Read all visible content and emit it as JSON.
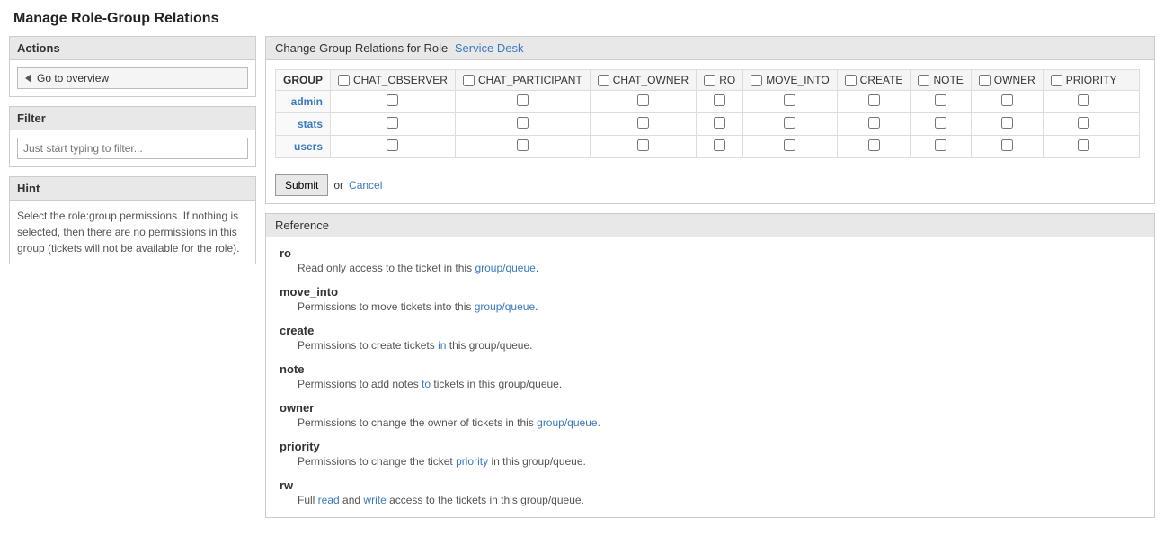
{
  "page": {
    "title": "Manage Role-Group Relations"
  },
  "sidebar": {
    "actions_title": "Actions",
    "goto_overview_label": "Go to overview",
    "filter_title": "Filter",
    "filter_placeholder": "Just start typing to filter...",
    "hint_title": "Hint",
    "hint_text": "Select the role:group permissions. If nothing is selected, then there are no permissions in this group (tickets will not be available for the role)."
  },
  "main": {
    "change_group_title_prefix": "Change Group Relations for Role",
    "role_name": "Service Desk",
    "columns": [
      {
        "id": "group",
        "label": "GROUP",
        "has_checkbox": false
      },
      {
        "id": "chat_observer",
        "label": "CHAT_OBSERVER",
        "has_checkbox": true
      },
      {
        "id": "chat_participant",
        "label": "CHAT_PARTICIPANT",
        "has_checkbox": true
      },
      {
        "id": "chat_owner",
        "label": "CHAT_OWNER",
        "has_checkbox": true
      },
      {
        "id": "ro",
        "label": "RO",
        "has_checkbox": true
      },
      {
        "id": "move_into",
        "label": "MOVE_INTO",
        "has_checkbox": true
      },
      {
        "id": "create",
        "label": "CREATE",
        "has_checkbox": true
      },
      {
        "id": "note",
        "label": "NOTE",
        "has_checkbox": true
      },
      {
        "id": "owner",
        "label": "OWNER",
        "has_checkbox": true
      },
      {
        "id": "priority",
        "label": "PRIORITY",
        "has_checkbox": true
      }
    ],
    "rows": [
      {
        "group": "admin",
        "group_link": true
      },
      {
        "group": "stats",
        "group_link": true
      },
      {
        "group": "users",
        "group_link": true
      }
    ],
    "submit_label": "Submit",
    "or_text": "or",
    "cancel_label": "Cancel",
    "reference_title": "Reference",
    "reference_items": [
      {
        "term": "ro",
        "desc_parts": [
          {
            "text": "Read only access to the ticket in this ",
            "link": false
          },
          {
            "text": "group/queue",
            "link": true
          },
          {
            "text": ".",
            "link": false
          }
        ]
      },
      {
        "term": "move_into",
        "desc_parts": [
          {
            "text": "Permissions to move tickets into this ",
            "link": false
          },
          {
            "text": "group/queue",
            "link": true
          },
          {
            "text": ".",
            "link": false
          }
        ]
      },
      {
        "term": "create",
        "desc_parts": [
          {
            "text": "Permissions to create tickets ",
            "link": false
          },
          {
            "text": "in",
            "link": true
          },
          {
            "text": " this group/queue.",
            "link": false
          }
        ]
      },
      {
        "term": "note",
        "desc_parts": [
          {
            "text": "Permissions to add notes ",
            "link": false
          },
          {
            "text": "to",
            "link": true
          },
          {
            "text": " tickets in this group/queue.",
            "link": false
          }
        ]
      },
      {
        "term": "owner",
        "desc_parts": [
          {
            "text": "Permissions to change the owner of tickets in this ",
            "link": false
          },
          {
            "text": "group/queue",
            "link": true
          },
          {
            "text": ".",
            "link": false
          }
        ]
      },
      {
        "term": "priority",
        "desc_parts": [
          {
            "text": "Permissions to change the ticket ",
            "link": false
          },
          {
            "text": "priority",
            "link": true
          },
          {
            "text": " in this group/queue.",
            "link": false
          }
        ]
      },
      {
        "term": "rw",
        "desc_parts": [
          {
            "text": "Full ",
            "link": false
          },
          {
            "text": "read",
            "link": true
          },
          {
            "text": " and ",
            "link": false
          },
          {
            "text": "write",
            "link": true
          },
          {
            "text": " access to the tickets in this group/queue.",
            "link": false
          }
        ]
      }
    ]
  }
}
